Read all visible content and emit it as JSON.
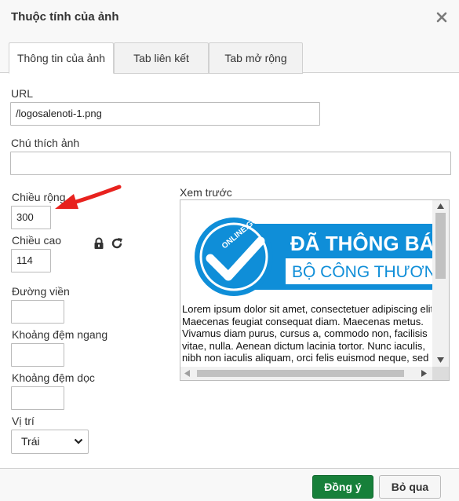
{
  "dialog": {
    "title": "Thuộc tính của ảnh",
    "close_icon": "close-icon"
  },
  "tabs": [
    {
      "label": "Thông tin của ảnh",
      "active": true
    },
    {
      "label": "Tab liên kết",
      "active": false
    },
    {
      "label": "Tab mở rộng",
      "active": false
    }
  ],
  "form": {
    "url_label": "URL",
    "url_value": "/logosalenoti-1.png",
    "caption_label": "Chú thích ảnh",
    "caption_value": "",
    "width_label": "Chiều rộng",
    "width_value": "300",
    "height_label": "Chiều cao",
    "height_value": "114",
    "lock_icon": "lock-icon",
    "reset_icon": "reset-size-icon",
    "border_label": "Đường viền",
    "border_value": "",
    "hspace_label": "Khoảng đệm ngang",
    "hspace_value": "",
    "vspace_label": "Khoảng đệm dọc",
    "vspace_value": "",
    "align_label": "Vị trí",
    "align_selected": "Trái"
  },
  "preview": {
    "label": "Xem trước",
    "logo": {
      "seal_text": "ONLINE.GOV.VN",
      "line1": "ĐÃ THÔNG BÁO",
      "line2": "BỘ CÔNG THƯƠNG",
      "brand_color": "#0f8ed8"
    },
    "lorem_lines": [
      "Lorem ipsum dolor sit amet, consectetuer adipiscing elit.",
      "Maecenas feugiat consequat diam. Maecenas metus.",
      "Vivamus diam purus, cursus a, commodo non, facilisis",
      "vitae, nulla. Aenean dictum lacinia tortor. Nunc iaculis,",
      "nibh non iaculis aliquam, orci felis euismod neque, sed"
    ]
  },
  "footer": {
    "ok_label": "Đồng ý",
    "cancel_label": "Bỏ qua"
  },
  "annotation": {
    "arrow_color": "#e8221e"
  }
}
